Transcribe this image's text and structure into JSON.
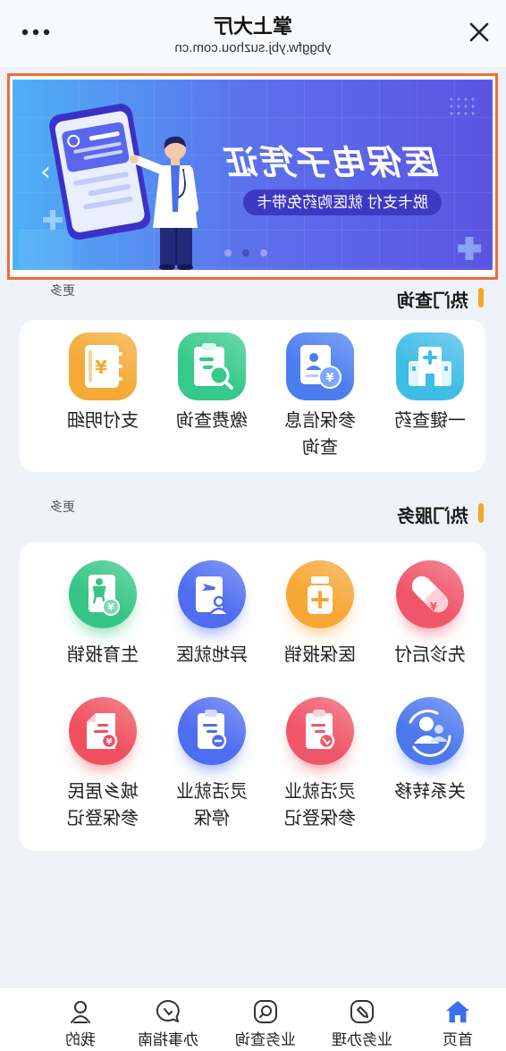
{
  "header": {
    "title": "掌上大厅",
    "url": "ybggfw.ybj.suzhou.com.cn"
  },
  "banner": {
    "title": "医保电子凭证",
    "subtitle": "脱卡支付 就医购药免带卡"
  },
  "hot_query": {
    "title": "热门查询",
    "more": "更多",
    "items": [
      {
        "label": "一键查药",
        "icon": "hospital-icon",
        "color": "#3fbde6"
      },
      {
        "label": "参保信息查询",
        "icon": "insurance-card-icon",
        "color": "#4c7df0"
      },
      {
        "label": "缴费查询",
        "icon": "payment-search-icon",
        "color": "#35c98a"
      },
      {
        "label": "支付明细",
        "icon": "payment-ledger-icon",
        "color": "#f4aa35"
      }
    ]
  },
  "hot_service": {
    "title": "热门服务",
    "more": "更多",
    "items": [
      {
        "label": "先诊后付",
        "icon": "capsule-icon",
        "color": "#f0566a"
      },
      {
        "label": "医保报销",
        "icon": "medicine-bottle-icon",
        "color": "#f6a635"
      },
      {
        "label": "异地就医",
        "icon": "travel-card-icon",
        "color": "#4f6df0"
      },
      {
        "label": "生育报销",
        "icon": "maternity-card-icon",
        "color": "#35c586"
      },
      {
        "label": "关系转移",
        "icon": "transfer-users-icon",
        "color": "#4d78ee"
      },
      {
        "label": "灵活就业参保登记",
        "icon": "register-clipboard-icon",
        "color": "#f0566a"
      },
      {
        "label": "灵活就业停保",
        "icon": "stop-clipboard-icon",
        "color": "#4f6df0"
      },
      {
        "label": "城乡居民参保登记",
        "icon": "resident-document-icon",
        "color": "#f04f5e"
      }
    ]
  },
  "tabbar": {
    "items": [
      {
        "label": "首页",
        "icon": "home-icon",
        "active": true
      },
      {
        "label": "业务办理",
        "icon": "business-handle-icon",
        "active": false
      },
      {
        "label": "业务查询",
        "icon": "business-search-icon",
        "active": false
      },
      {
        "label": "办事指南",
        "icon": "guide-chat-icon",
        "active": false
      },
      {
        "label": "我的",
        "icon": "profile-icon",
        "active": false
      }
    ]
  },
  "colors": {
    "accent": "#3a6ff0",
    "section_bar": "#f5a623",
    "highlight_outline": "#f26b3a",
    "page_bg": "#eff3f9"
  }
}
